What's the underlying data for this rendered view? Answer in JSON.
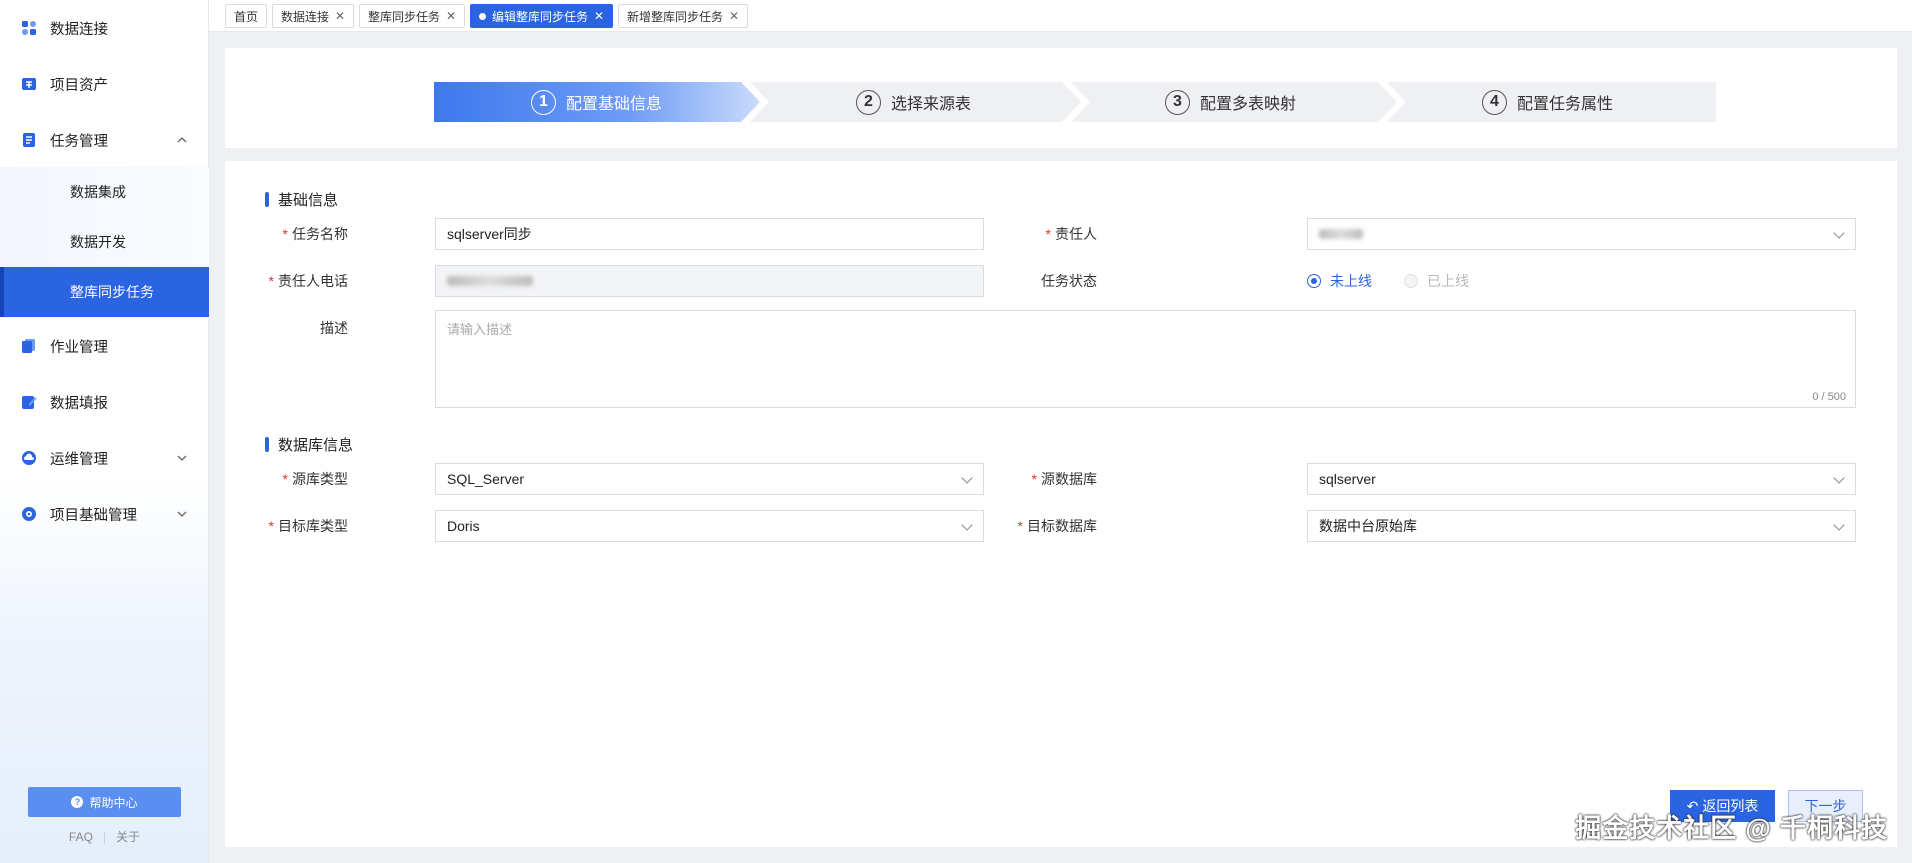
{
  "sidebar": {
    "items": [
      {
        "label": "数据连接",
        "icon": "link-icon"
      },
      {
        "label": "项目资产",
        "icon": "asset-icon"
      },
      {
        "label": "任务管理",
        "icon": "task-icon"
      },
      {
        "label": "作业管理",
        "icon": "job-icon"
      },
      {
        "label": "数据填报",
        "icon": "form-icon"
      },
      {
        "label": "运维管理",
        "icon": "ops-icon"
      },
      {
        "label": "项目基础管理",
        "icon": "gear-icon"
      }
    ],
    "sub_items": [
      "数据集成",
      "数据开发",
      "整库同步任务"
    ],
    "help_label": "帮助中心",
    "faq": "FAQ",
    "about": "关于"
  },
  "tabs": [
    "首页",
    "数据连接",
    "整库同步任务",
    "编辑整库同步任务",
    "新增整库同步任务"
  ],
  "steps": [
    {
      "num": "1",
      "label": "配置基础信息"
    },
    {
      "num": "2",
      "label": "选择来源表"
    },
    {
      "num": "3",
      "label": "配置多表映射"
    },
    {
      "num": "4",
      "label": "配置任务属性"
    }
  ],
  "basic": {
    "title": "基础信息",
    "task_name_label": "任务名称",
    "task_name_value": "sqlserver同步",
    "owner_label": "责任人",
    "phone_label": "责任人电话",
    "status_label": "任务状态",
    "status_offline": "未上线",
    "status_online": "已上线",
    "desc_label": "描述",
    "desc_placeholder": "请输入描述",
    "desc_count": "0 / 500"
  },
  "db": {
    "title": "数据库信息",
    "src_type_label": "源库类型",
    "src_type_value": "SQL_Server",
    "src_db_label": "源数据库",
    "src_db_value": "sqlserver",
    "tgt_type_label": "目标库类型",
    "tgt_type_value": "Doris",
    "tgt_db_label": "目标数据库",
    "tgt_db_value": "数据中台原始库"
  },
  "buttons": {
    "back": "返回列表",
    "next": "下一步"
  },
  "watermark": "掘金技术社区 @ 千桐科技",
  "colors": {
    "primary": "#2a64e0",
    "required": "#e0332f"
  }
}
